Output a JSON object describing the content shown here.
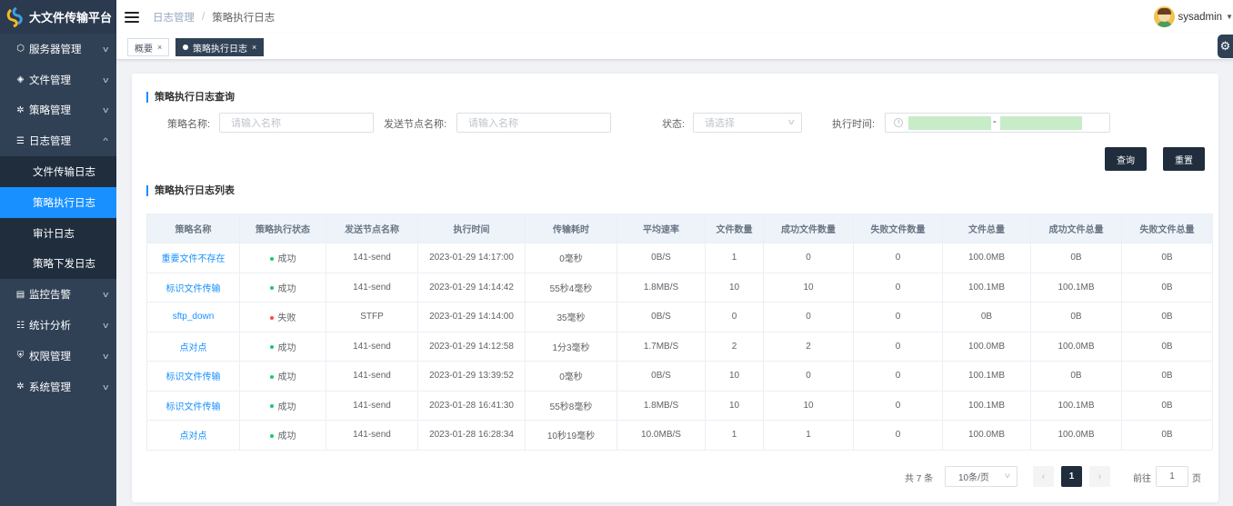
{
  "app": {
    "title": "大文件传输平台"
  },
  "sidebar": {
    "items": [
      {
        "label": "服务器管理",
        "icon": "cube-icon"
      },
      {
        "label": "文件管理",
        "icon": "layers-icon"
      },
      {
        "label": "策略管理",
        "icon": "gear-icon"
      },
      {
        "label": "日志管理",
        "icon": "log-icon",
        "expanded": true,
        "children": [
          {
            "label": "文件传输日志"
          },
          {
            "label": "策略执行日志",
            "active": true
          },
          {
            "label": "审计日志"
          },
          {
            "label": "策略下发日志"
          }
        ]
      },
      {
        "label": "监控告警",
        "icon": "monitor-icon"
      },
      {
        "label": "统计分析",
        "icon": "chart-icon"
      },
      {
        "label": "权限管理",
        "icon": "shield-icon"
      },
      {
        "label": "系统管理",
        "icon": "gear-icon"
      }
    ]
  },
  "header": {
    "breadcrumb": [
      "日志管理",
      "策略执行日志"
    ],
    "username": "sysadmin"
  },
  "tags": [
    {
      "label": "概要",
      "active": false
    },
    {
      "label": "策略执行日志",
      "active": true
    }
  ],
  "query": {
    "section_title": "策略执行日志查询",
    "policy_name_label": "策略名称:",
    "policy_name_placeholder": "请输入名称",
    "node_name_label": "发送节点名称:",
    "node_name_placeholder": "请输入名称",
    "status_label": "状态:",
    "status_placeholder": "请选择",
    "exec_time_label": "执行时间:",
    "date_separator": "-",
    "search_button": "查询",
    "reset_button": "重置"
  },
  "list": {
    "section_title": "策略执行日志列表",
    "columns": [
      "策略名称",
      "策略执行状态",
      "发送节点名称",
      "执行时间",
      "传输耗时",
      "平均速率",
      "文件数量",
      "成功文件数量",
      "失败文件数量",
      "文件总量",
      "成功文件总量",
      "失败文件总量"
    ],
    "rows": [
      [
        "重要文件不存在",
        "成功",
        "141-send",
        "2023-01-29 14:17:00",
        "0毫秒",
        "0B/S",
        "1",
        "0",
        "0",
        "100.0MB",
        "0B",
        "0B"
      ],
      [
        "标识文件传输",
        "成功",
        "141-send",
        "2023-01-29 14:14:42",
        "55秒4毫秒",
        "1.8MB/S",
        "10",
        "10",
        "0",
        "100.1MB",
        "100.1MB",
        "0B"
      ],
      [
        "sftp_down",
        "失败",
        "STFP",
        "2023-01-29 14:14:00",
        "35毫秒",
        "0B/S",
        "0",
        "0",
        "0",
        "0B",
        "0B",
        "0B"
      ],
      [
        "点对点",
        "成功",
        "141-send",
        "2023-01-29 14:12:58",
        "1分3毫秒",
        "1.7MB/S",
        "2",
        "2",
        "0",
        "100.0MB",
        "100.0MB",
        "0B"
      ],
      [
        "标识文件传输",
        "成功",
        "141-send",
        "2023-01-29 13:39:52",
        "0毫秒",
        "0B/S",
        "10",
        "0",
        "0",
        "100.1MB",
        "0B",
        "0B"
      ],
      [
        "标识文件传输",
        "成功",
        "141-send",
        "2023-01-28 16:41:30",
        "55秒8毫秒",
        "1.8MB/S",
        "10",
        "10",
        "0",
        "100.1MB",
        "100.1MB",
        "0B"
      ],
      [
        "点对点",
        "成功",
        "141-send",
        "2023-01-28 16:28:34",
        "10秒19毫秒",
        "10.0MB/S",
        "1",
        "1",
        "0",
        "100.0MB",
        "100.0MB",
        "0B"
      ]
    ]
  },
  "pagination": {
    "total_text": "共 7 条",
    "page_size": "10条/页",
    "current_page": "1",
    "goto_label": "前往",
    "goto_value": "1",
    "goto_suffix": "页"
  },
  "colors": {
    "sidebar_bg": "#304156",
    "accent": "#1890ff",
    "dark_button": "#1f2d3d",
    "success": "#13ce66",
    "fail": "#ff4949"
  }
}
